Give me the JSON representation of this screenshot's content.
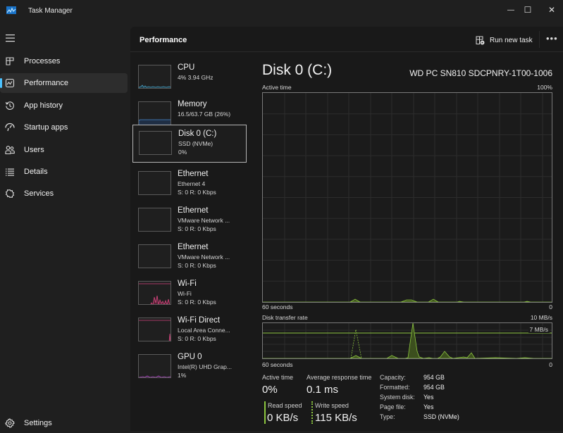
{
  "window": {
    "title": "Task Manager",
    "controls": {
      "minimize": "—",
      "maximize": "☐",
      "close": "✕"
    }
  },
  "sidebar": {
    "items": [
      {
        "label": "Processes",
        "icon": "processes-icon"
      },
      {
        "label": "Performance",
        "icon": "performance-icon",
        "active": true
      },
      {
        "label": "App history",
        "icon": "app-history-icon"
      },
      {
        "label": "Startup apps",
        "icon": "startup-apps-icon"
      },
      {
        "label": "Users",
        "icon": "users-icon"
      },
      {
        "label": "Details",
        "icon": "details-icon"
      },
      {
        "label": "Services",
        "icon": "services-icon"
      }
    ],
    "settings_label": "Settings",
    "accent": "#4cc2ff"
  },
  "header": {
    "title": "Performance",
    "run_new_task": "Run new task",
    "more": "•••"
  },
  "devices": [
    {
      "name": "CPU",
      "sub1": "4% 3.94 GHz",
      "sub2": "",
      "graph_color": "#4aa3c7"
    },
    {
      "name": "Memory",
      "sub1": "16.5/63.7 GB (26%)",
      "sub2": "",
      "graph_color": "#4a8bd0",
      "usage": 0.26
    },
    {
      "name": "Disk 0 (C:)",
      "sub1": "SSD (NVMe)",
      "sub2": "0%",
      "selected": true,
      "graph_color": "#8cc63f"
    },
    {
      "name": "Ethernet",
      "sub1": "Ethernet 4",
      "sub2": "S: 0 R: 0 Kbps"
    },
    {
      "name": "Ethernet",
      "sub1": "VMware Network ...",
      "sub2": "S: 0 R: 0 Kbps"
    },
    {
      "name": "Ethernet",
      "sub1": "VMware Network ...",
      "sub2": "S: 0 R: 0 Kbps"
    },
    {
      "name": "Wi-Fi",
      "sub1": "Wi-Fi",
      "sub2": "S: 0 R: 0 Kbps",
      "graph_color": "#d6457f"
    },
    {
      "name": "Wi-Fi Direct",
      "sub1": "Local Area Conne...",
      "sub2": "S: 0 R: 0 Kbps",
      "graph_color": "#d6457f"
    },
    {
      "name": "GPU 0",
      "sub1": "Intel(R) UHD Grap...",
      "sub2": "1%",
      "graph_color": "#b04fc4"
    }
  ],
  "detail": {
    "title": "Disk 0 (C:)",
    "model": "WD PC SN810 SDCPNRY-1T00-1006",
    "active_time_graph": {
      "label": "Active time",
      "max_label": "100%",
      "x_label": "60 seconds",
      "min_label": "0",
      "color": "#8cc63f"
    },
    "transfer_graph": {
      "label": "Disk transfer rate",
      "max_label": "10 MB/s",
      "line_label": "7 MB/s",
      "line_value_mbps": 7,
      "x_label": "60 seconds",
      "min_label": "0",
      "color": "#8cc63f"
    },
    "stats": {
      "active_time_label": "Active time",
      "active_time": "0%",
      "avg_response_label": "Average response time",
      "avg_response": "0.1 ms",
      "read_label": "Read speed",
      "read": "0 KB/s",
      "write_label": "Write speed",
      "write": "115 KB/s"
    },
    "specs": [
      {
        "key": "Capacity:",
        "value": "954 GB"
      },
      {
        "key": "Formatted:",
        "value": "954 GB"
      },
      {
        "key": "System disk:",
        "value": "Yes"
      },
      {
        "key": "Page file:",
        "value": "Yes"
      },
      {
        "key": "Type:",
        "value": "SSD (NVMe)"
      }
    ]
  }
}
